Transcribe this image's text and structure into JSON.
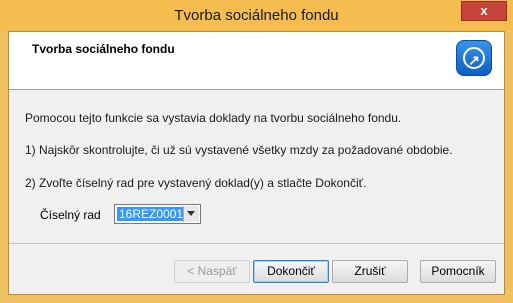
{
  "window": {
    "title": "Tvorba sociálneho fondu",
    "close_label": "x"
  },
  "header": {
    "title": "Tvorba sociálneho fondu",
    "logo_icon": "app-logo-icon"
  },
  "body": {
    "intro": "Pomocou tejto funkcie sa vystavia doklady na tvorbu sociálneho fondu.",
    "step1": "1) Najskôr skontrolujte, či už sú vystavené všetky mzdy za požadované obdobie.",
    "step2": "2) Zvoľte číselný rad pre vystavený doklad(y) a stlačte Dokončiť."
  },
  "number_series": {
    "label": "Číselný rad",
    "value": "16REZ0001"
  },
  "buttons": {
    "back": "< Naspäť",
    "finish": "Dokončiť",
    "cancel": "Zrušiť",
    "help": "Pomocník"
  }
}
